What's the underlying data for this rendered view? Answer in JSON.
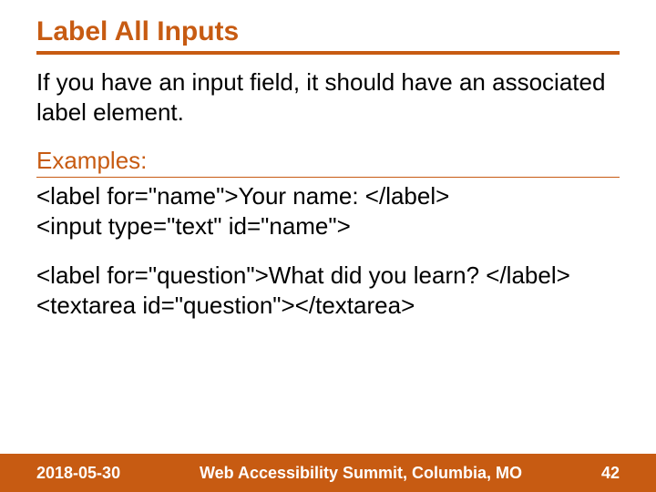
{
  "title": "Label All Inputs",
  "body": "If you have an input field, it should have an associated label element.",
  "examples_heading": "Examples:",
  "example1": "<label for=\"name\">Your name: </label>\n<input type=\"text\" id=\"name\">",
  "example2": "<label for=\"question\">What did you learn? </label>\n<textarea id=\"question\"></textarea>",
  "footer": {
    "date": "2018-05-30",
    "venue": "Web Accessibility Summit, Columbia, MO",
    "page": "42"
  }
}
